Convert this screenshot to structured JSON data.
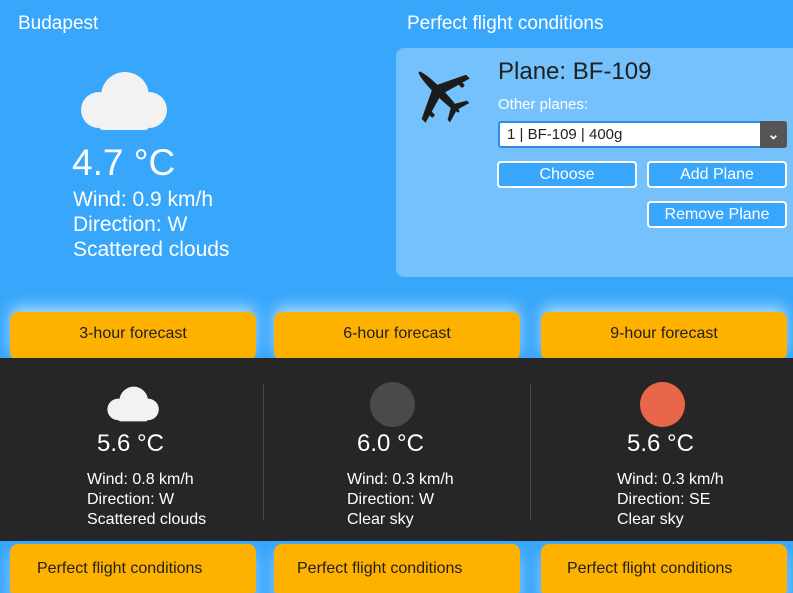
{
  "current": {
    "city": "Budapest",
    "icon": "cloud-icon",
    "temperature": "4.7 °C",
    "wind": "Wind: 0.9 km/h",
    "direction": "Direction: W",
    "description": "Scattered clouds"
  },
  "flight": {
    "status": "Perfect flight conditions",
    "plane_icon": "airplane-icon",
    "plane_name": "Plane: BF-109",
    "other_planes_label": "Other planes:",
    "selected_plane": "1 | BF-109 | 400g",
    "choose_label": "Choose",
    "add_label": "Add Plane",
    "remove_label": "Remove Plane"
  },
  "forecasts": [
    {
      "title": "3-hour forecast",
      "icon": "cloud-icon",
      "temperature": "5.6 °C",
      "wind": "Wind: 0.8 km/h",
      "direction": "Direction: W",
      "description": "Scattered clouds",
      "status": "Perfect flight conditions"
    },
    {
      "title": "6-hour forecast",
      "icon": "moon-icon",
      "icon_color": "#4a4a4a",
      "temperature": "6.0 °C",
      "wind": "Wind: 0.3 km/h",
      "direction": "Direction: W",
      "description": "Clear sky",
      "status": "Perfect flight conditions"
    },
    {
      "title": "9-hour forecast",
      "icon": "sun-icon",
      "icon_color": "#e8664a",
      "temperature": "5.6 °C",
      "wind": "Wind: 0.3 km/h",
      "direction": "Direction: SE",
      "description": "Clear sky",
      "status": "Perfect flight conditions"
    }
  ],
  "colors": {
    "background": "#38a6fb",
    "panel": "#75c1fb",
    "accent": "#ffb100",
    "forecast_band": "#262626"
  }
}
